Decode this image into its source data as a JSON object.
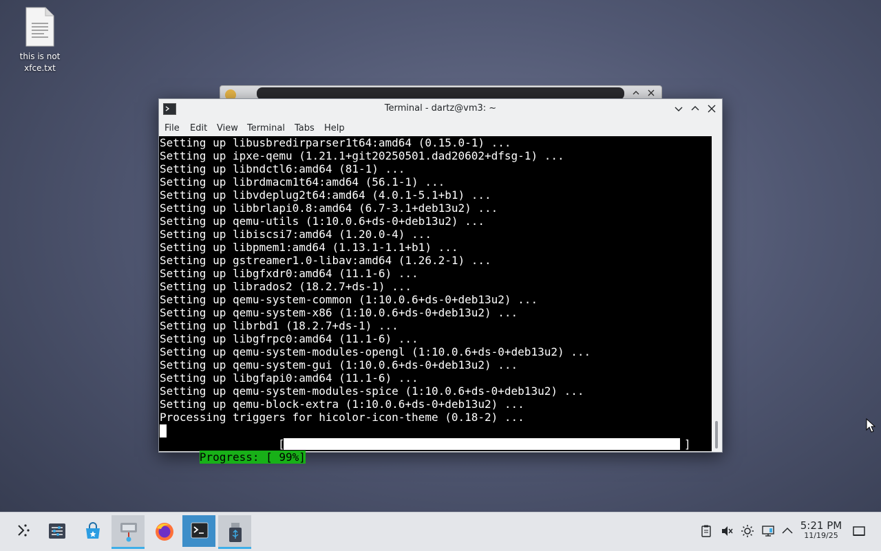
{
  "desktop": {
    "icons": [
      {
        "label": "this is not xfce.txt",
        "icon": "text-file-icon"
      }
    ]
  },
  "background_window": {
    "icon": "app-icon"
  },
  "terminal_window": {
    "title": "Terminal - dartz@vm3: ~",
    "menu": [
      "File",
      "Edit",
      "View",
      "Terminal",
      "Tabs",
      "Help"
    ],
    "lines": [
      "Setting up libusbredirparser1t64:amd64 (0.15.0-1) ...",
      "Setting up ipxe-qemu (1.21.1+git20250501.dad20602+dfsg-1) ...",
      "Setting up libndctl6:amd64 (81-1) ...",
      "Setting up librdmacm1t64:amd64 (56.1-1) ...",
      "Setting up libvdeplug2t64:amd64 (4.0.1-5.1+b1) ...",
      "Setting up libbrlapi0.8:amd64 (6.7-3.1+deb13u2) ...",
      "Setting up qemu-utils (1:10.0.6+ds-0+deb13u2) ...",
      "Setting up libiscsi7:amd64 (1.20.0-4) ...",
      "Setting up libpmem1:amd64 (1.13.1-1.1+b1) ...",
      "Setting up gstreamer1.0-libav:amd64 (1.26.2-1) ...",
      "Setting up libgfxdr0:amd64 (11.1-6) ...",
      "Setting up librados2 (18.2.7+ds-1) ...",
      "Setting up qemu-system-common (1:10.0.6+ds-0+deb13u2) ...",
      "Setting up qemu-system-x86 (1:10.0.6+ds-0+deb13u2) ...",
      "Setting up librbd1 (18.2.7+ds-1) ...",
      "Setting up libgfrpc0:amd64 (11.1-6) ...",
      "Setting up qemu-system-modules-opengl (1:10.0.6+ds-0+deb13u2) ...",
      "Setting up qemu-system-gui (1:10.0.6+ds-0+deb13u2) ...",
      "Setting up libgfapi0:amd64 (11.1-6) ...",
      "Setting up qemu-system-modules-spice (1:10.0.6+ds-0+deb13u2) ...",
      "Setting up qemu-block-extra (1:10.0.6+ds-0+deb13u2) ...",
      "Processing triggers for hicolor-icon-theme (0.18-2) ..."
    ],
    "progress_label": "Progress: [ 99%]",
    "bracket_open": "[",
    "bracket_close": "]",
    "progress_fraction": 0.99
  },
  "taskbar": {
    "launcher_icon": "kde-launcher-icon",
    "pinned": [
      "system-settings-icon",
      "discover-icon",
      "virt-manager-icon",
      "firefox-icon",
      "terminal-icon",
      "usb-flasher-icon"
    ],
    "tray": [
      "clipboard-icon",
      "volume-muted-icon",
      "brightness-icon",
      "network-icon",
      "expand-tray-icon"
    ],
    "clock": {
      "time": "5:21 PM",
      "date": "11/19/25"
    },
    "show_desktop_icon": "show-desktop-icon"
  },
  "colors": {
    "accent": "#3daee9",
    "progress_green": "#18b018",
    "terminal_bg": "#000000"
  }
}
